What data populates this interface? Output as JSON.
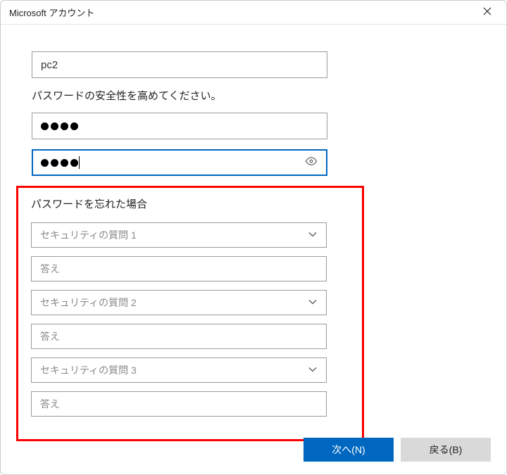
{
  "window": {
    "title": "Microsoft アカウント"
  },
  "form": {
    "username": "pc2",
    "password_instruction": "パスワードの安全性を高めてください。",
    "password1_masked": "••••",
    "password2_masked": "••••"
  },
  "forgot": {
    "title": "パスワードを忘れた場合",
    "q1_placeholder": "セキュリティの質問 1",
    "a1_placeholder": "答え",
    "q2_placeholder": "セキュリティの質問 2",
    "a2_placeholder": "答え",
    "q3_placeholder": "セキュリティの質問 3",
    "a3_placeholder": "答え"
  },
  "footer": {
    "next": "次へ(N)",
    "back": "戻る(B)"
  }
}
